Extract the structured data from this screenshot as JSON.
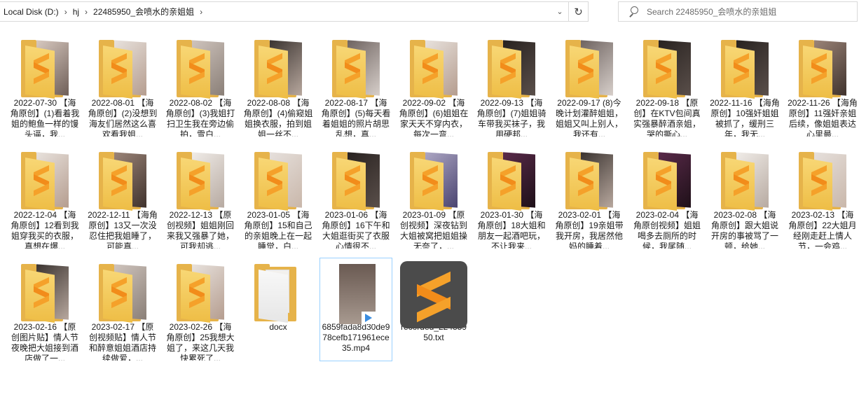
{
  "breadcrumb": [
    "Local Disk (D:)",
    "hj",
    "22485950_会喷水的亲姐姐"
  ],
  "search": {
    "placeholder": "Search 22485950_会喷水的亲姐姐"
  },
  "items": [
    {
      "label": "2022-07-30 【海角原创】(1)看着我姐的鲍鱼一样的馒头逼，我...",
      "kind": "folder",
      "photo": "ph1"
    },
    {
      "label": "2022-08-01 【海角原创】(2)没想到海友们居然这么喜欢看我姐...",
      "kind": "folder",
      "photo": "ph2"
    },
    {
      "label": "2022-08-02 【海角原创】(3)我姐打扫卫生我在旁边偷拍，雪白...",
      "kind": "folder",
      "photo": "ph3"
    },
    {
      "label": "2022-08-08 【海角原创】(4)偷窥姐姐换衣服，拍到姐姐一丝不...",
      "kind": "folder",
      "photo": "ph4"
    },
    {
      "label": "2022-08-17 【海角原创】(5)每天看着姐姐的照片胡思乱想，真...",
      "kind": "folder",
      "photo": "ph5"
    },
    {
      "label": "2022-09-02 【海角原创】(6)姐姐在家天天不穿内衣，每次一弯...",
      "kind": "folder",
      "photo": "ph2"
    },
    {
      "label": "2022-09-13 【海角原创】(7)姐姐骑车带我买袜子，我用硬邦...",
      "kind": "folder",
      "photo": "ph6"
    },
    {
      "label": "2022-09-17 (8)今晚计划灌醉姐姐，姐姐又叫上别人，我还有...",
      "kind": "folder",
      "photo": "ph5"
    },
    {
      "label": "2022-09-18 【原创】在KTV包间真实强暴醉酒亲姐，哭的撕心...",
      "kind": "folder",
      "photo": "ph6"
    },
    {
      "label": "2022-11-16 【海角原创】10强奸姐姐被抓了，缓刑三年，我无...",
      "kind": "folder",
      "photo": "ph6"
    },
    {
      "label": "2022-11-26 【海角原创】11强奸亲姐后续，像姐姐表达心里最...",
      "kind": "folder",
      "photo": "ph7"
    },
    {
      "label": "2022-12-04 【海角原创】12看到我姐穿我买的衣服，真想在爆...",
      "kind": "folder",
      "photo": "ph2"
    },
    {
      "label": "2022-12-11 【海角原创】13又一次没忍住把我姐睡了，可能真...",
      "kind": "folder",
      "photo": "ph7"
    },
    {
      "label": "2022-12-13 【原创视频】姐姐刚回来我又强暴了她，可我却逃...",
      "kind": "folder",
      "photo": "ph8"
    },
    {
      "label": "2023-01-05 【海角原创】15和自己的亲姐晚上在一起睡觉，白...",
      "kind": "folder",
      "photo": "ph10"
    },
    {
      "label": "2023-01-06 【海角原创】16下午和大姐逛街买了衣服心情很不...",
      "kind": "folder",
      "photo": "ph6"
    },
    {
      "label": "2023-01-09 【原创视频】深夜钻到大姐被窝把姐姐操无奈了，...",
      "kind": "folder",
      "photo": "ph11"
    },
    {
      "label": "2023-01-30 【海角原创】18大姐和朋友一起酒吧玩，不让我来...",
      "kind": "folder",
      "photo": "ph9"
    },
    {
      "label": "2023-02-01 【海角原创】19亲姐带我开房，我居然他妈的睡着...",
      "kind": "folder",
      "photo": "ph4"
    },
    {
      "label": "2023-02-04 【海角原创视频】姐姐喝多去厕所的时候，我尾随...",
      "kind": "folder",
      "photo": "ph9"
    },
    {
      "label": "2023-02-08 【海角原创】跟大姐说开房的事被骂了一顿，给她...",
      "kind": "folder",
      "photo": "ph8"
    },
    {
      "label": "2023-02-13 【海角原创】22大姐月经刚走赶上情人节，一会鸡...",
      "kind": "folder",
      "photo": "ph10"
    },
    {
      "label": "2023-02-16 【原创图片贴】情人节夜晚把大姐接到酒店做了一...",
      "kind": "folder",
      "photo": "ph4"
    },
    {
      "label": "2023-02-17 【原创视频贴】情人节和醉意姐姐酒店持续做爱，...",
      "kind": "folder",
      "photo": "ph3"
    },
    {
      "label": "2023-02-26 【海角原创】25我想大姐了，来这几天我快累死了...",
      "kind": "folder",
      "photo": "ph2"
    },
    {
      "label": "docx",
      "kind": "docfolder",
      "photo": ""
    },
    {
      "label": "6859fada8d30de978cefb171961ece35.mp4",
      "kind": "video",
      "photo": "",
      "selected": true
    },
    {
      "label": "recorded_22485950.txt",
      "kind": "sublime",
      "photo": ""
    }
  ]
}
